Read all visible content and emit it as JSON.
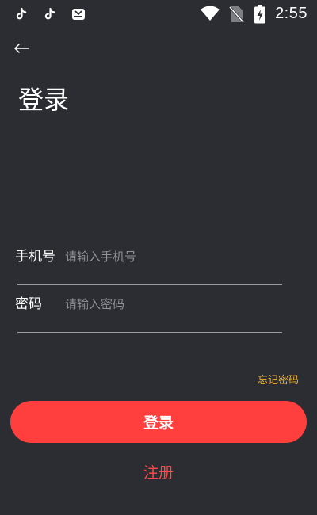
{
  "status_bar": {
    "time": "2:55",
    "left_icons": [
      "tiktok-icon",
      "tiktok-icon",
      "app-notification-icon"
    ],
    "right_icons": [
      "wifi-icon",
      "no-sim-icon",
      "battery-charging-icon"
    ]
  },
  "header": {
    "back_icon": "arrow-left-icon",
    "title": "登录"
  },
  "form": {
    "phone_label": "手机号",
    "phone_placeholder": "请输入手机号",
    "password_label": "密码",
    "password_placeholder": "请输入密码",
    "forgot_password": "忘记密码"
  },
  "actions": {
    "login_label": "登录",
    "register_label": "注册"
  },
  "colors": {
    "background": "#2b2d32",
    "accent_red": "#ff3f3d",
    "link_orange": "#f2b233"
  }
}
